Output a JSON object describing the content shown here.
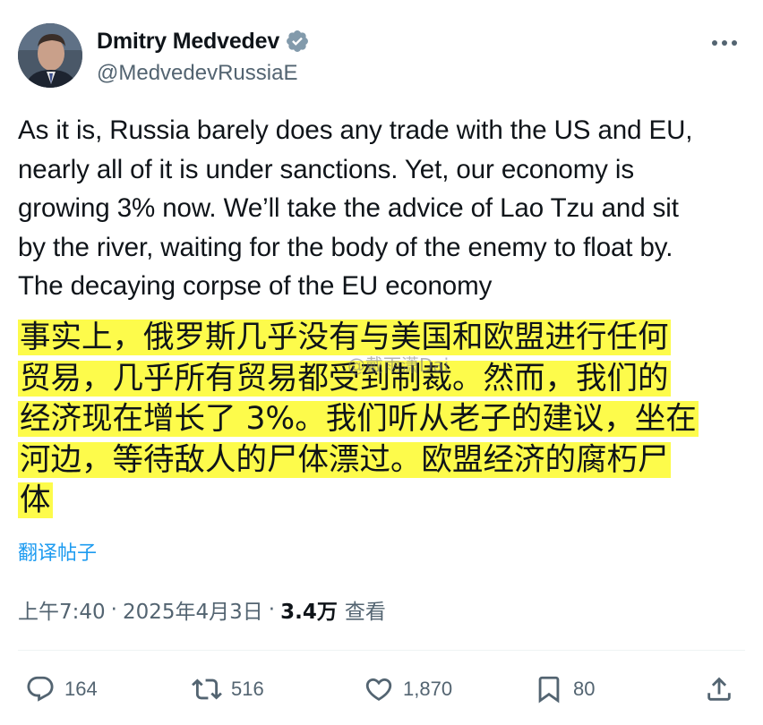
{
  "author": {
    "display_name": "Dmitry Medvedev",
    "handle": "@MedvedevRussiaE",
    "avatar_icon": "profile-photo",
    "verified_icon": "verified-badge-icon",
    "verified_color": "#829aab"
  },
  "tweet": {
    "lines": [
      "As it is, Russia barely does any trade with the US and EU,",
      "nearly all of it is under sanctions. Yet, our economy is",
      "growing 3% now. We’ll take the advice of Lao Tzu and sit",
      "by the river, waiting for the body of the enemy to float by.",
      "The decaying corpse of the EU economy"
    ]
  },
  "translation": {
    "lines": [
      "事实上，俄罗斯几乎没有与美国和欧盟进行任何",
      "贸易，几乎所有贸易都受到制裁。然而，我们的",
      "经济现在增长了 3%。我们听从老子的建议，坐在",
      "河边，等待敌人的尸体漂过。欧盟经济的腐朽尸",
      "体"
    ],
    "highlight_color": "#fdfb4b",
    "watermark": "@戴雨潇Dai"
  },
  "translate_link": "翻译帖子",
  "meta": {
    "time": "上午7:40",
    "date": "2025年4月3日",
    "views_count": "3.4万",
    "views_label": "查看",
    "separator": "·"
  },
  "actions": {
    "replies": "164",
    "retweets": "516",
    "likes": "1,870",
    "bookmarks": "80"
  },
  "colors": {
    "text": "#0f1419",
    "secondary": "#536471",
    "link": "#1d9bf0"
  }
}
